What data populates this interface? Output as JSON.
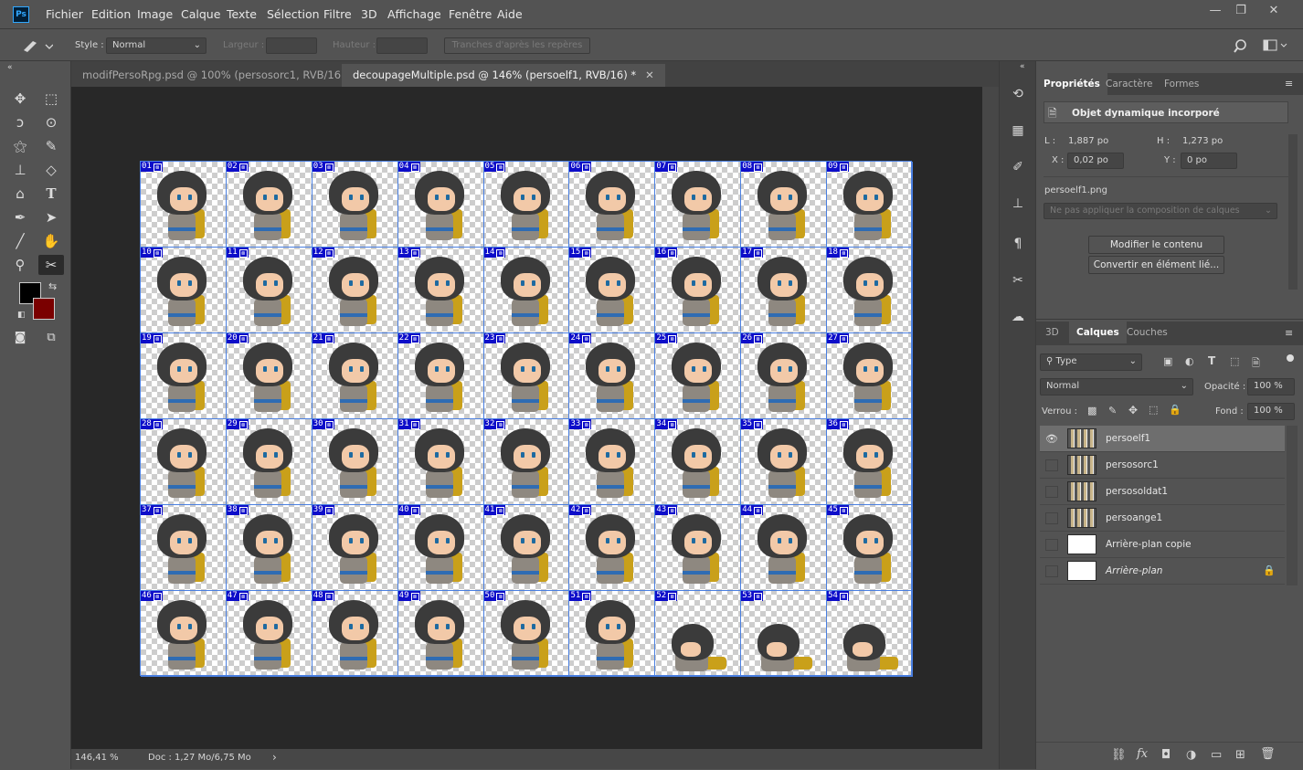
{
  "app": {
    "logo": "Ps"
  },
  "menu": [
    "Fichier",
    "Edition",
    "Image",
    "Calque",
    "Texte",
    "Sélection",
    "Filtre",
    "3D",
    "Affichage",
    "Fenêtre",
    "Aide"
  ],
  "window_controls": {
    "minimize": "—",
    "maximize": "❐",
    "close": "✕"
  },
  "options": {
    "style_label": "Style :",
    "style_value": "Normal",
    "width_label": "Largeur :",
    "height_label": "Hauteur :",
    "slices_button": "Tranches d'après les repères"
  },
  "tabs": [
    {
      "label": "modifPersoRpg.psd @ 100% (persosorc1, RVB/16)",
      "close": "✕"
    },
    {
      "label": "decoupageMultiple.psd @ 146% (persoelf1, RVB/16) *",
      "close": "✕"
    }
  ],
  "status": {
    "zoom": "146,41 %",
    "doc": "Doc : 1,27 Mo/6,75 Mo",
    "arrow": "›"
  },
  "slices": {
    "count": 54,
    "columns": 9,
    "rows": 6,
    "labels": [
      "01",
      "02",
      "03",
      "04",
      "05",
      "06",
      "07",
      "08",
      "09",
      "10",
      "11",
      "12",
      "13",
      "14",
      "15",
      "16",
      "17",
      "18",
      "19",
      "20",
      "21",
      "22",
      "23",
      "24",
      "25",
      "26",
      "27",
      "28",
      "29",
      "30",
      "31",
      "32",
      "33",
      "34",
      "35",
      "36",
      "37",
      "38",
      "39",
      "40",
      "41",
      "42",
      "43",
      "44",
      "45",
      "46",
      "47",
      "48",
      "49",
      "50",
      "51",
      "52",
      "53",
      "54"
    ]
  },
  "properties": {
    "tabs": [
      "Propriétés",
      "Caractère",
      "Formes"
    ],
    "object_type": "Objet dynamique incorporé",
    "w_label": "L :",
    "w_value": "1,887 po",
    "h_label": "H :",
    "h_value": "1,273 po",
    "x_label": "X :",
    "x_value": "0,02 po",
    "y_label": "Y :",
    "y_value": "0 po",
    "filename": "persoelf1.png",
    "comp_select": "Ne pas appliquer la composition de calques",
    "edit_button": "Modifier le contenu",
    "convert_button": "Convertir en élément lié..."
  },
  "layers_panel": {
    "tabs": [
      "3D",
      "Calques",
      "Couches"
    ],
    "filter": "Type",
    "blend_mode": "Normal",
    "opacity_label": "Opacité :",
    "opacity_value": "100 %",
    "lock_label": "Verrou :",
    "fill_label": "Fond :",
    "fill_value": "100 %",
    "layers": [
      {
        "name": "persoelf1",
        "visible": true,
        "selected": true
      },
      {
        "name": "persosorc1",
        "visible": false
      },
      {
        "name": "persosoldat1",
        "visible": false
      },
      {
        "name": "persoange1",
        "visible": false
      },
      {
        "name": "Arrière-plan copie",
        "visible": false
      },
      {
        "name": "Arrière-plan",
        "visible": false,
        "locked": true
      }
    ]
  },
  "colors": {
    "foreground": "#000000",
    "background": "#7a0000",
    "accent": "#31a8ff",
    "slice_badge": "#0d0dc9"
  }
}
